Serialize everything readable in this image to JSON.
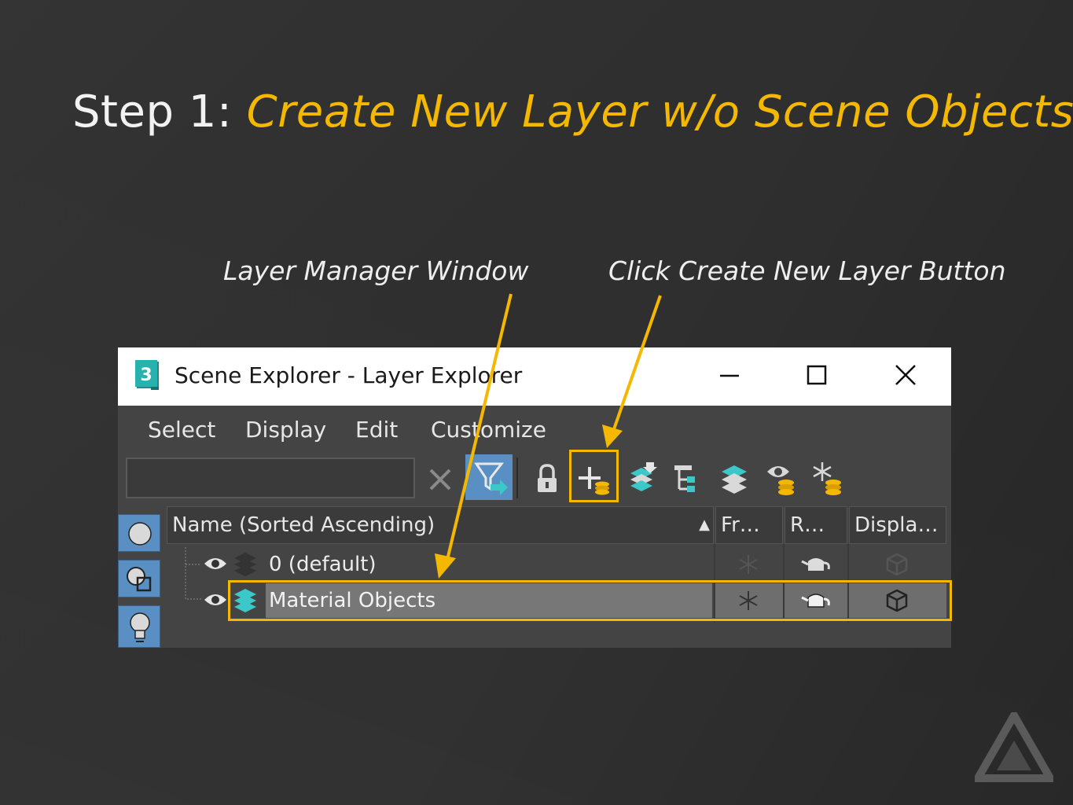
{
  "slide": {
    "title_prefix": "Step 1: ",
    "title_accent": "Create New Layer w/o Scene Objects",
    "callout_left": "Layer Manager Window",
    "callout_right": "Click Create New Layer Button"
  },
  "colors": {
    "accent": "#f5b800",
    "background": "#2f2f2f",
    "window_bg": "#444444",
    "selected_row": "#777777",
    "side_tab_blue": "#5a8fc4",
    "layer_icon_teal": "#3cc8c8"
  },
  "window": {
    "title": "Scene Explorer - Layer Explorer",
    "app_icon": "3ds-max-app-icon",
    "app_icon_text": "3",
    "controls": [
      "minimize-icon",
      "maximize-icon",
      "close-icon"
    ]
  },
  "menubar": {
    "items": [
      "Select",
      "Display",
      "Edit",
      "Customize"
    ]
  },
  "toolbar": {
    "search_value": "",
    "buttons": [
      "clear-search-icon",
      "filter-icon",
      "lock-icon",
      "create-new-layer-icon",
      "add-to-layer-icon",
      "layer-hierarchy-icon",
      "layers-icon",
      "hide-layers-icon",
      "freeze-layers-icon"
    ]
  },
  "side_tabs": [
    "circle-icon",
    "layered-shapes-icon",
    "lightbulb-icon"
  ],
  "grid": {
    "columns": [
      "Name (Sorted Ascending)",
      "Fr…",
      "R…",
      "Displa…"
    ],
    "sort_indicator": "▲",
    "rows": [
      {
        "name": "0 (default)",
        "selected": false,
        "icons": [
          "eye-icon",
          "layer-stack-icon",
          "snowflake-icon",
          "teapot-icon",
          "cube-icon"
        ]
      },
      {
        "name": "Material Objects",
        "selected": true,
        "icons": [
          "eye-icon",
          "layer-stack-icon",
          "snowflake-icon",
          "teapot-icon",
          "cube-icon"
        ]
      }
    ]
  },
  "brand_logo": "triangle-logo-icon"
}
